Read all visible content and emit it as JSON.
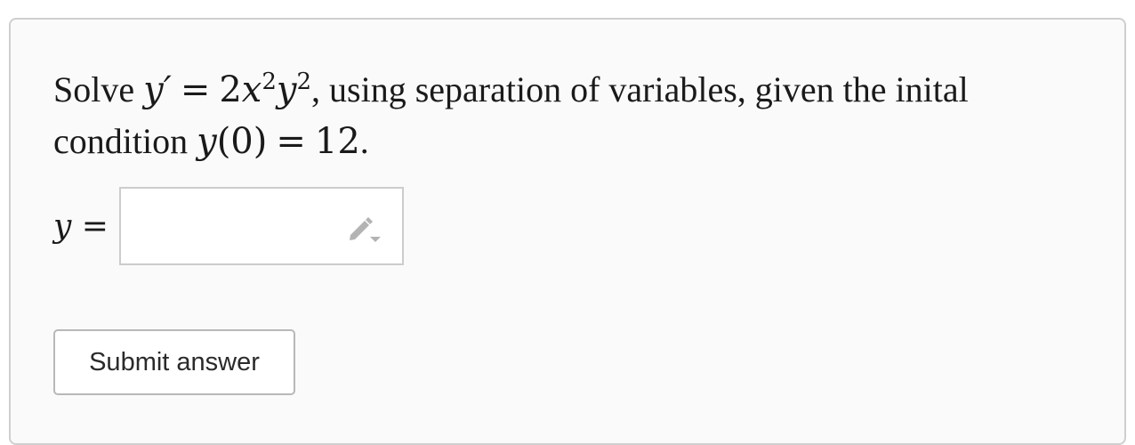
{
  "question": {
    "prefix": "Solve",
    "equation": {
      "lhs": "y′",
      "eq": "=",
      "coef": "2",
      "var1": "x",
      "exp1": "2",
      "var2": "y",
      "exp2": "2"
    },
    "middle": ", using separation of variables, given the inital condition",
    "condition": {
      "func": "y",
      "arg": "(0)",
      "eq": "=",
      "value": "12"
    },
    "suffix": "."
  },
  "answer": {
    "label_var": "y",
    "label_eq": "=",
    "value": "",
    "placeholder": "",
    "edit_icon": "pencil-dropdown-icon"
  },
  "submit": {
    "label": "Submit answer"
  }
}
